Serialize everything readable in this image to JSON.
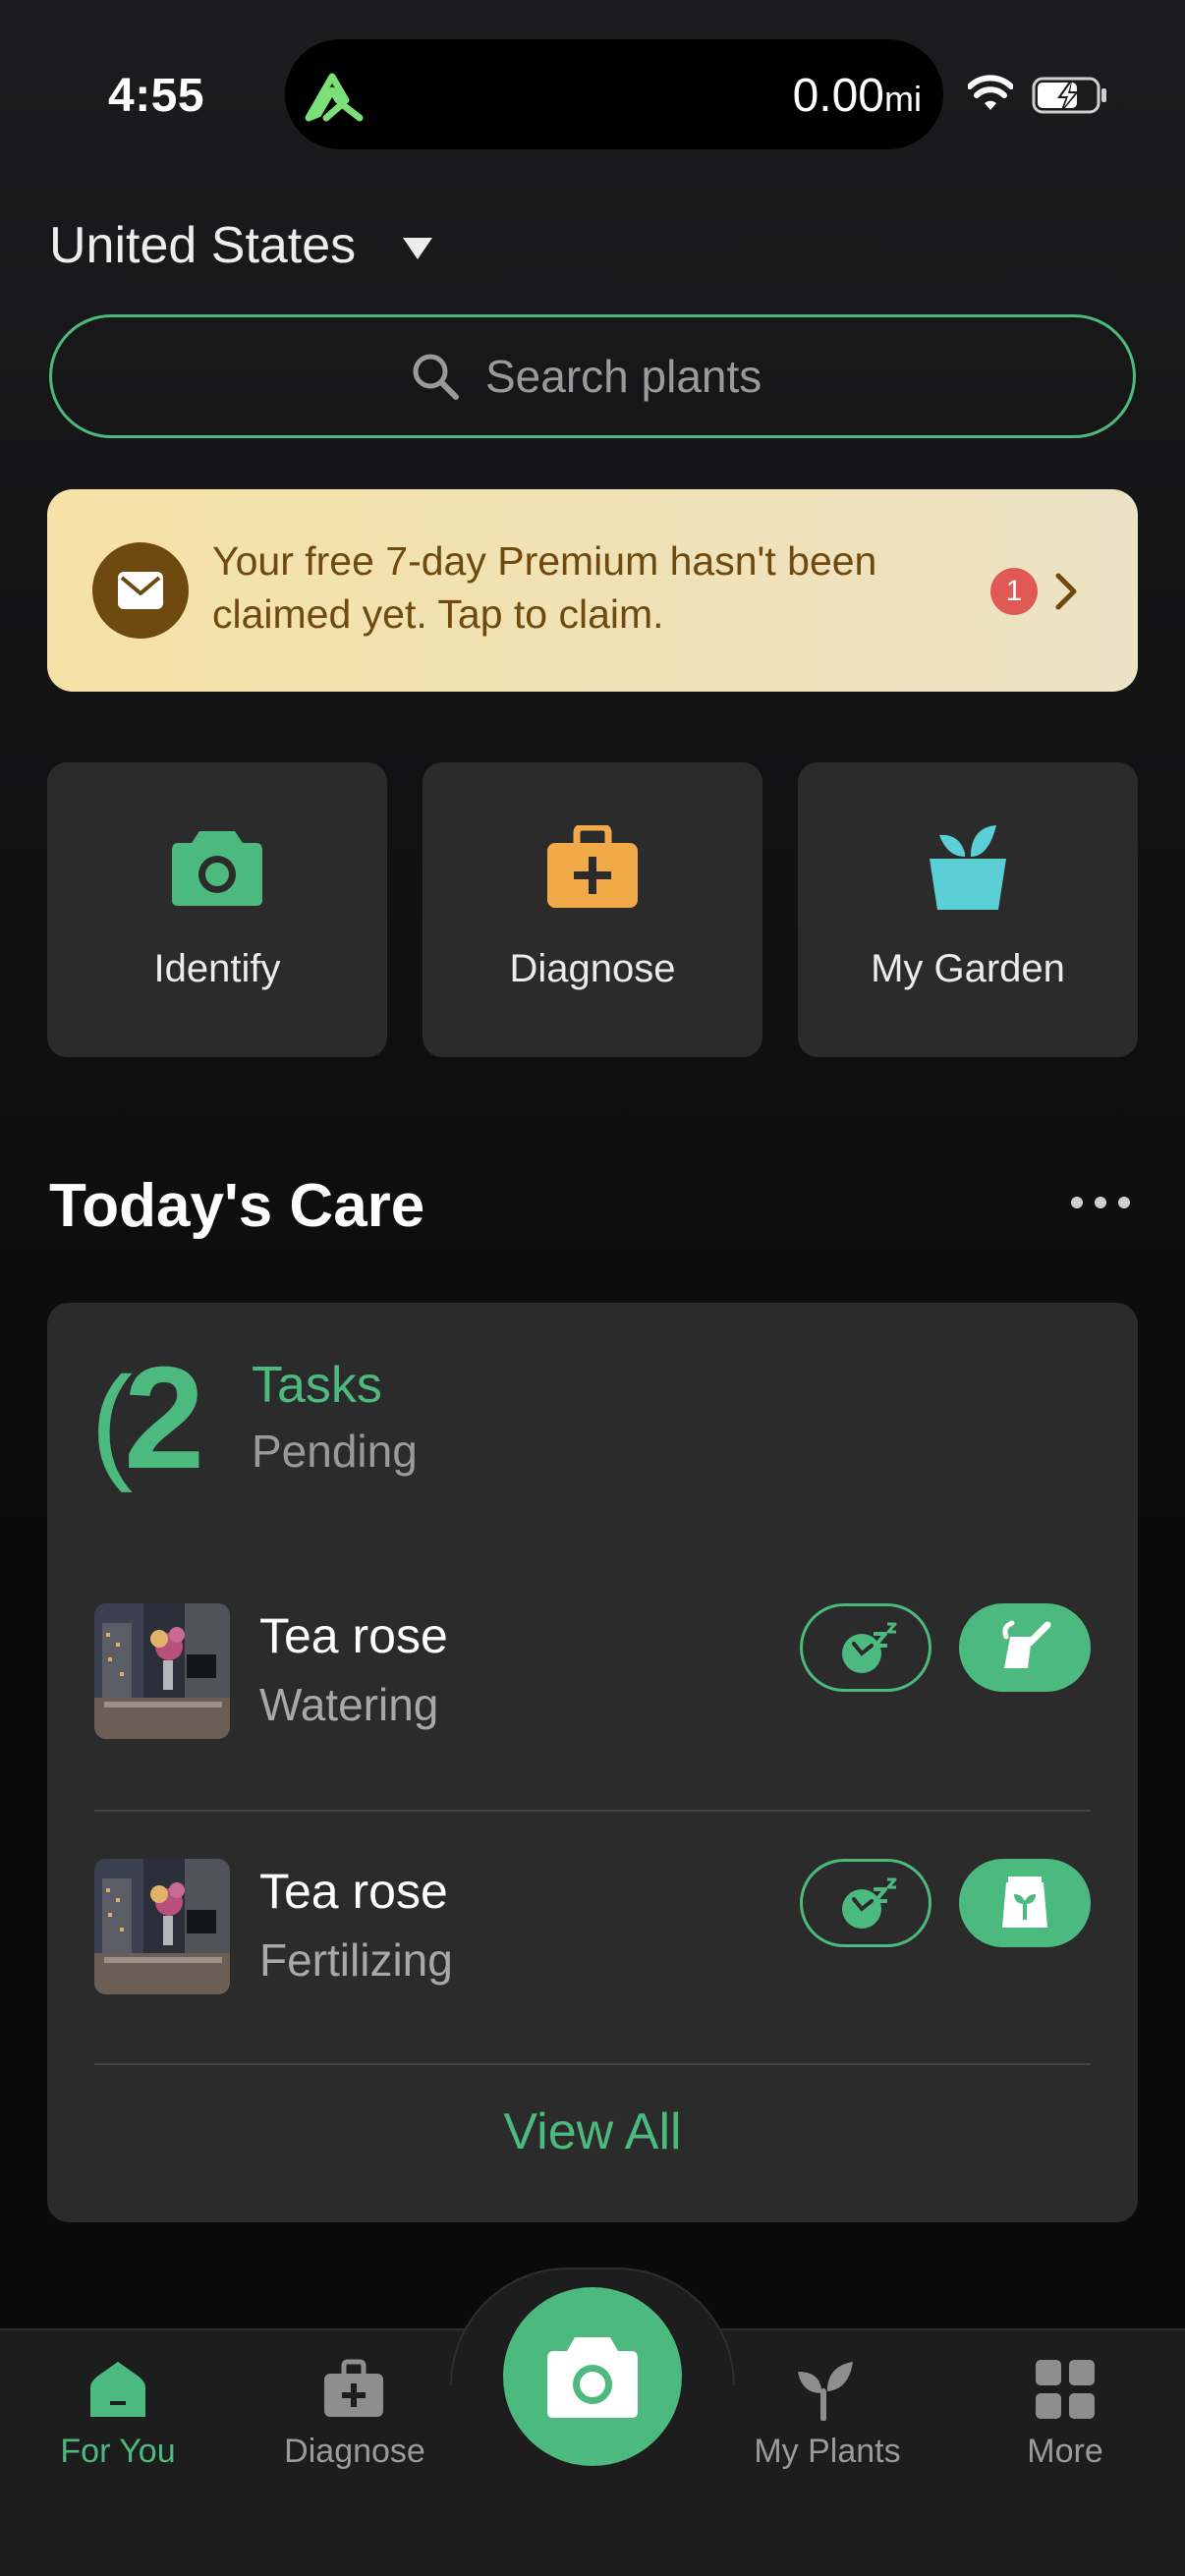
{
  "status_bar": {
    "time": "4:55",
    "distance": "0.00",
    "distance_unit": "mi"
  },
  "header": {
    "location": "United States"
  },
  "search": {
    "placeholder": "Search plants"
  },
  "promo": {
    "text": "Your free 7-day Premium hasn't been claimed yet. Tap to claim.",
    "badge_count": "1"
  },
  "actions": [
    {
      "label": "Identify",
      "icon": "camera-icon",
      "color": "#4cb97e"
    },
    {
      "label": "Diagnose",
      "icon": "first-aid-kit-icon",
      "color": "#f2aa48"
    },
    {
      "label": "My Garden",
      "icon": "plant-pot-icon",
      "color": "#5ad0d6"
    }
  ],
  "care": {
    "title": "Today's Care",
    "count": "2",
    "count_label": "Tasks",
    "status": "Pending",
    "tasks": [
      {
        "plant": "Tea rose",
        "task": "Watering",
        "action_icon": "watering-can-icon"
      },
      {
        "plant": "Tea rose",
        "task": "Fertilizing",
        "action_icon": "fertilizer-bag-icon"
      }
    ],
    "view_all": "View All"
  },
  "tabbar": {
    "tabs": [
      {
        "label": "For You",
        "active": true
      },
      {
        "label": "Diagnose",
        "active": false
      },
      {
        "label": "My Plants",
        "active": false
      },
      {
        "label": "More",
        "active": false
      }
    ]
  },
  "colors": {
    "accent": "#4cb97e",
    "banner_text": "#6f4a10",
    "badge": "#e05a55"
  }
}
